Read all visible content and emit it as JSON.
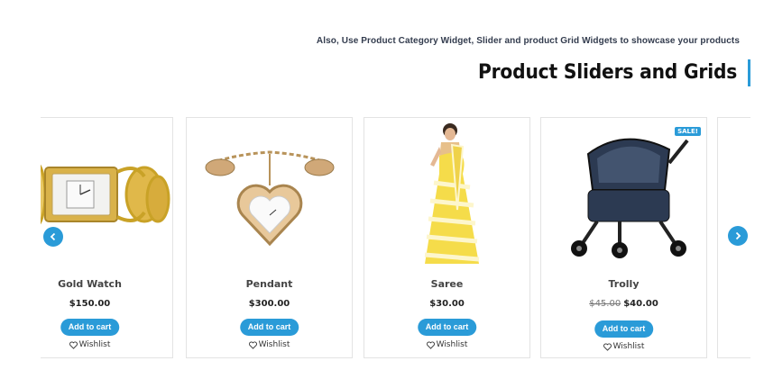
{
  "header": {
    "subtitle": "Also, Use Product Category Widget, Slider and product Grid Widgets to showcase your products",
    "title": "Product Sliders and Grids"
  },
  "products": [
    {
      "name": "Gold Watch",
      "price": "$150.00",
      "old_price": null,
      "cart_label": "Add to cart",
      "wishlist_label": "Wishlist",
      "badge": null
    },
    {
      "name": "Pendant",
      "price": "$300.00",
      "old_price": null,
      "cart_label": "Add to cart",
      "wishlist_label": "Wishlist",
      "badge": null
    },
    {
      "name": "Saree",
      "price": "$30.00",
      "old_price": null,
      "cart_label": "Add to cart",
      "wishlist_label": "Wishlist",
      "badge": null
    },
    {
      "name": "Trolly",
      "price": "$40.00",
      "old_price": "$45.00",
      "cart_label": "Add to cart",
      "wishlist_label": "Wishlist",
      "badge": "SALE!"
    }
  ],
  "colors": {
    "accent": "#2a9bd8",
    "title": "#111111",
    "subtitle": "#333c4e"
  }
}
